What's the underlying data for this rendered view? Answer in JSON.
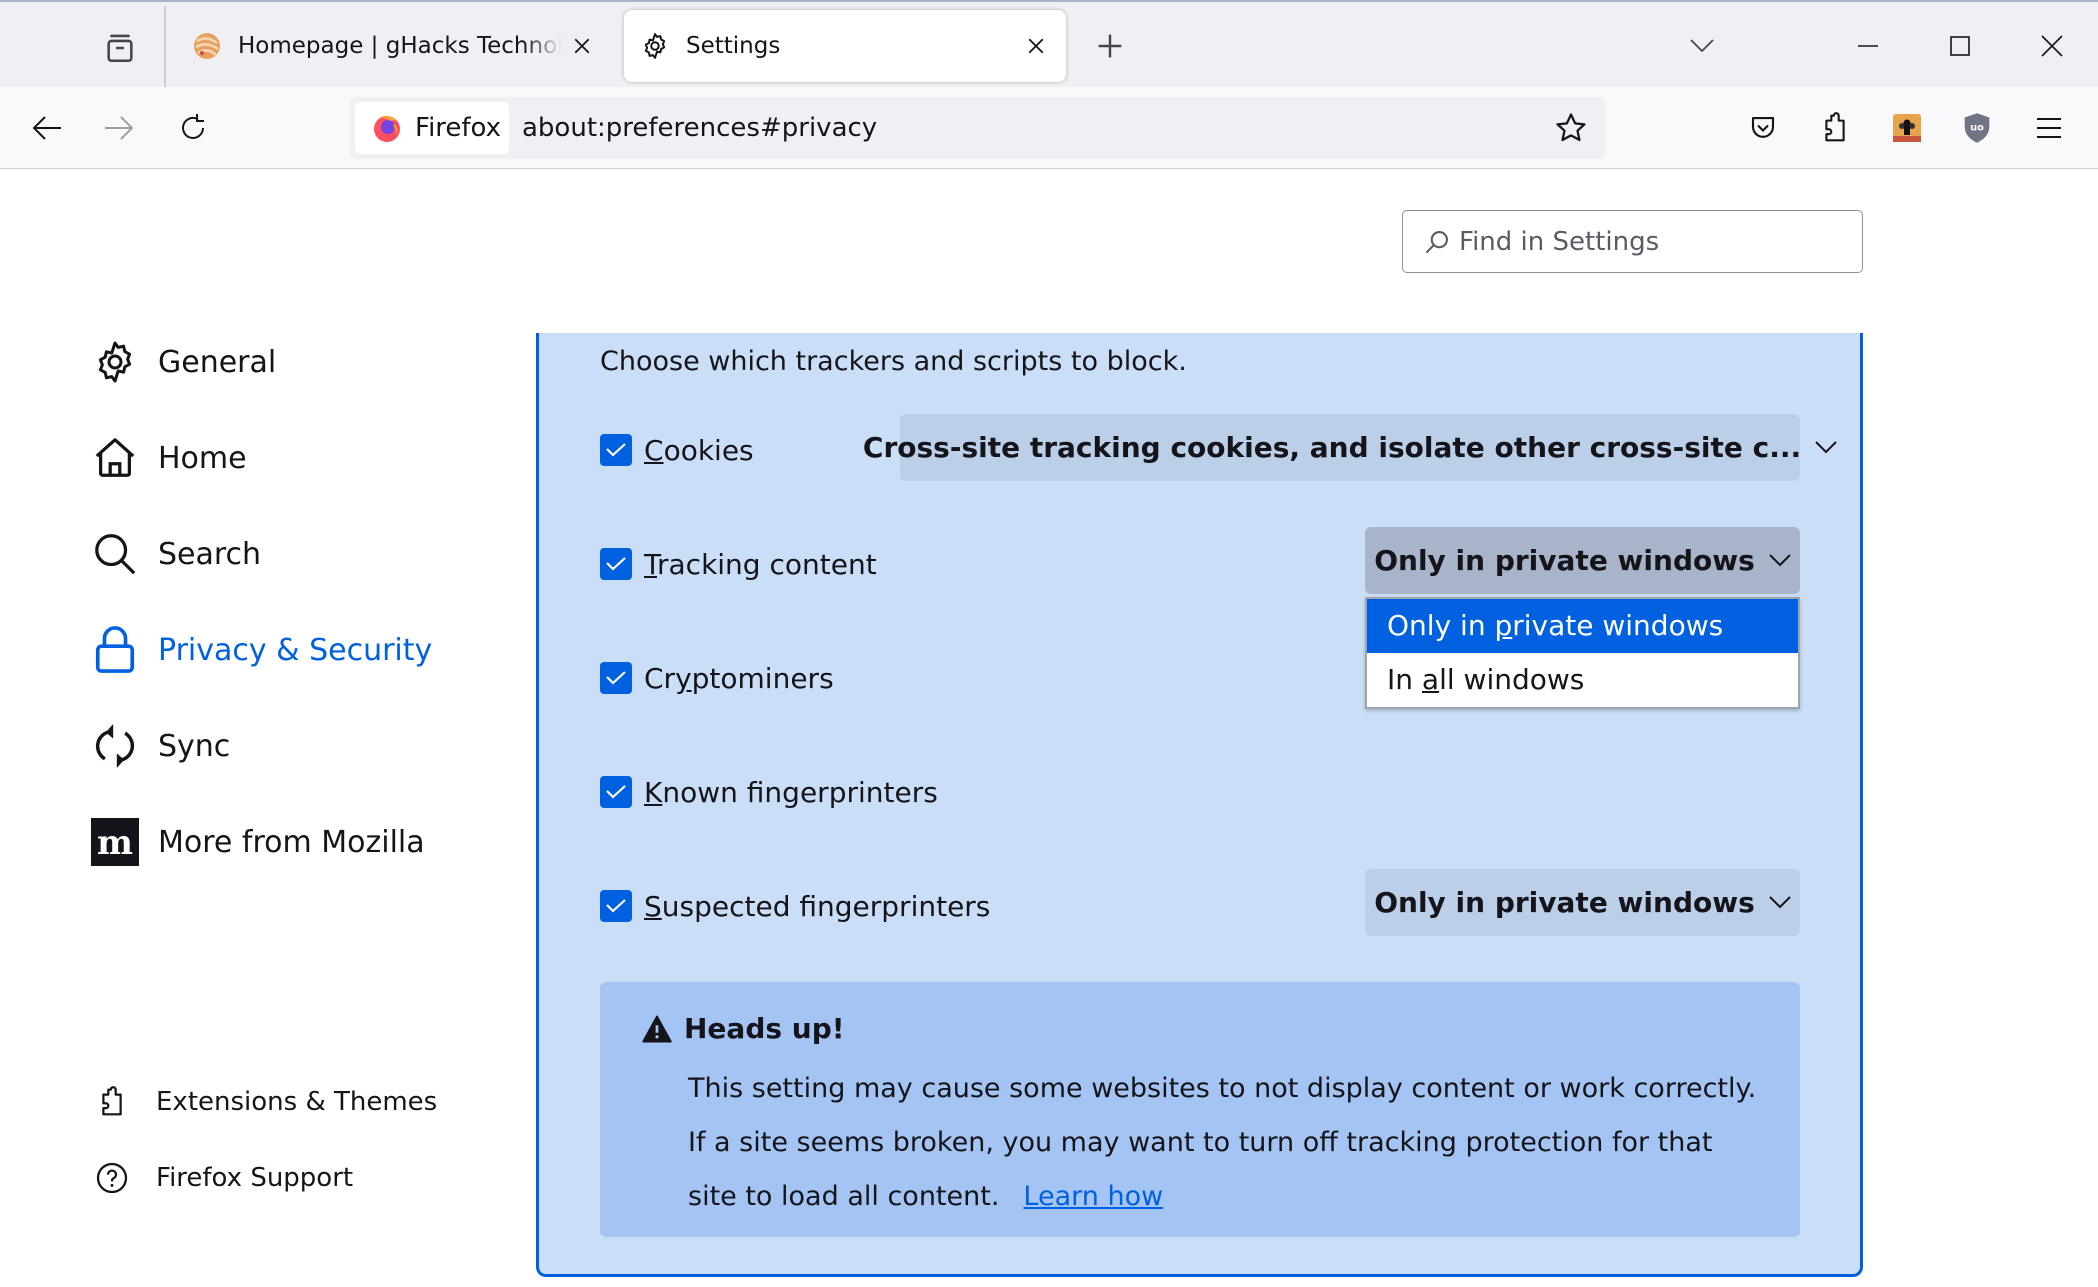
{
  "browser": {
    "tabs": [
      {
        "title": "Homepage | gHacks Technology News",
        "active": false,
        "favicon": "ghacks-favicon"
      },
      {
        "title": "Settings",
        "active": true,
        "favicon": "gear-icon"
      }
    ],
    "new_tab_label": "+",
    "identity_label": "Firefox",
    "url": "about:preferences#privacy",
    "toolbar_icons": [
      "pocket-icon",
      "extensions-icon",
      "extension-avatar-icon",
      "ublock-origin-icon",
      "menu-icon"
    ],
    "window_controls": [
      "minimize",
      "maximize",
      "close"
    ]
  },
  "search": {
    "placeholder": "Find in Settings",
    "value": ""
  },
  "sidebar": {
    "items": [
      {
        "label": "General",
        "icon": "gear-icon",
        "selected": false
      },
      {
        "label": "Home",
        "icon": "home-icon",
        "selected": false
      },
      {
        "label": "Search",
        "icon": "search-icon",
        "selected": false
      },
      {
        "label": "Privacy & Security",
        "icon": "lock-icon",
        "selected": true
      },
      {
        "label": "Sync",
        "icon": "sync-icon",
        "selected": false
      },
      {
        "label": "More from Mozilla",
        "icon": "mozilla-icon",
        "selected": false
      }
    ],
    "footer": [
      {
        "label": "Extensions & Themes",
        "icon": "puzzle-icon"
      },
      {
        "label": "Firefox Support",
        "icon": "help-icon"
      }
    ]
  },
  "custom_blocking": {
    "intro": "Choose which trackers and scripts to block.",
    "rows": [
      {
        "key": "C",
        "rest": "ookies",
        "checked": true,
        "dropdown": "Cross-site tracking cookies, and isolate other cross-site c..."
      },
      {
        "key": "T",
        "rest": "racking content",
        "checked": true,
        "dropdown": "Only in private windows"
      },
      {
        "pre": "Cr",
        "key": "y",
        "rest": "ptominers",
        "checked": true
      },
      {
        "key": "K",
        "rest": "nown fingerprinters",
        "checked": true
      },
      {
        "key": "S",
        "rest": "uspected fingerprinters",
        "checked": true,
        "dropdown": "Only in private windows"
      }
    ],
    "open_menu": {
      "options": [
        {
          "pre": "Only in ",
          "key": "p",
          "rest": "rivate windows",
          "selected": true
        },
        {
          "pre": "In ",
          "key": "a",
          "rest": "ll windows",
          "selected": false
        }
      ]
    }
  },
  "warning": {
    "title": "Heads up!",
    "body": "This setting may cause some websites to not display content or work correctly. If a site seems broken, you may want to turn off tracking protection for that site to load all content.",
    "link": "Learn how"
  },
  "colors": {
    "accent": "#0061e0",
    "panel_bg": "#cadff7",
    "warning_bg": "#a4c5f4",
    "dropdown_bg": "#bccfe9"
  }
}
